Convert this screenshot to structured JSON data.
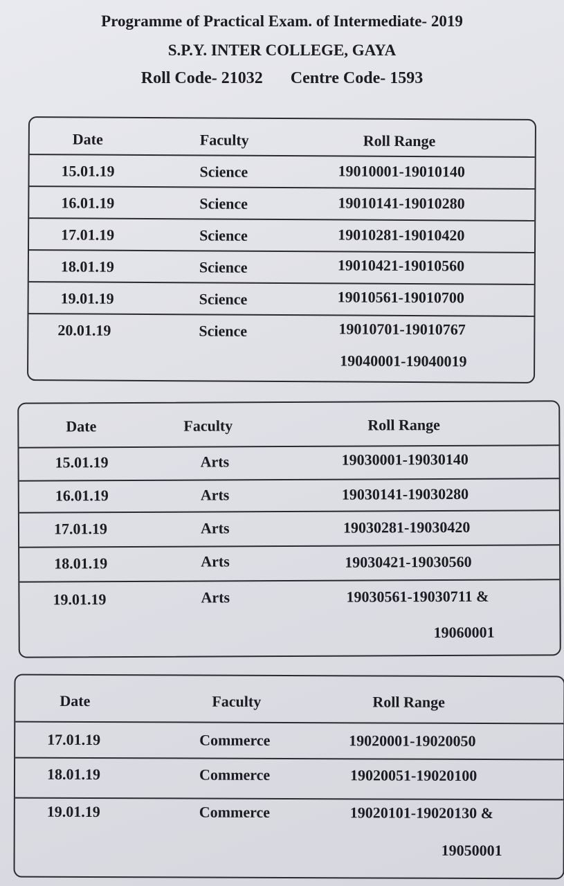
{
  "title": "Programme of Practical Exam. of Intermediate- 2019",
  "college": "S.P.Y. INTER COLLEGE, GAYA",
  "roll_code": "Roll Code- 21032",
  "centre_code": "Centre Code- 1593",
  "tables": [
    {
      "headers": {
        "date": "Date",
        "faculty": "Faculty",
        "roll_range": "Roll Range"
      },
      "rows": [
        {
          "date": "15.01.19",
          "faculty": "Science",
          "roll_range": "19010001-19010140"
        },
        {
          "date": "16.01.19",
          "faculty": "Science",
          "roll_range": "19010141-19010280"
        },
        {
          "date": "17.01.19",
          "faculty": "Science",
          "roll_range": "19010281-19010420"
        },
        {
          "date": "18.01.19",
          "faculty": "Science",
          "roll_range": "19010421-19010560"
        },
        {
          "date": "19.01.19",
          "faculty": "Science",
          "roll_range": "19010561-19010700"
        },
        {
          "date": "20.01.19",
          "faculty": "Science",
          "roll_range": "19010701-19010767",
          "roll_range_extra": "19040001-19040019"
        }
      ]
    },
    {
      "headers": {
        "date": "Date",
        "faculty": "Faculty",
        "roll_range": "Roll Range"
      },
      "rows": [
        {
          "date": "15.01.19",
          "faculty": "Arts",
          "roll_range": "19030001-19030140"
        },
        {
          "date": "16.01.19",
          "faculty": "Arts",
          "roll_range": "19030141-19030280"
        },
        {
          "date": "17.01.19",
          "faculty": "Arts",
          "roll_range": "19030281-19030420"
        },
        {
          "date": "18.01.19",
          "faculty": "Arts",
          "roll_range": "19030421-19030560"
        },
        {
          "date": "19.01.19",
          "faculty": "Arts",
          "roll_range": "19030561-19030711 &",
          "roll_range_extra": "19060001"
        }
      ]
    },
    {
      "headers": {
        "date": "Date",
        "faculty": "Faculty",
        "roll_range": "Roll Range"
      },
      "rows": [
        {
          "date": "17.01.19",
          "faculty": "Commerce",
          "roll_range": "19020001-19020050"
        },
        {
          "date": "18.01.19",
          "faculty": "Commerce",
          "roll_range": "19020051-19020100"
        },
        {
          "date": "19.01.19",
          "faculty": "Commerce",
          "roll_range": "19020101-19020130 &",
          "roll_range_extra": "19050001"
        }
      ]
    }
  ]
}
